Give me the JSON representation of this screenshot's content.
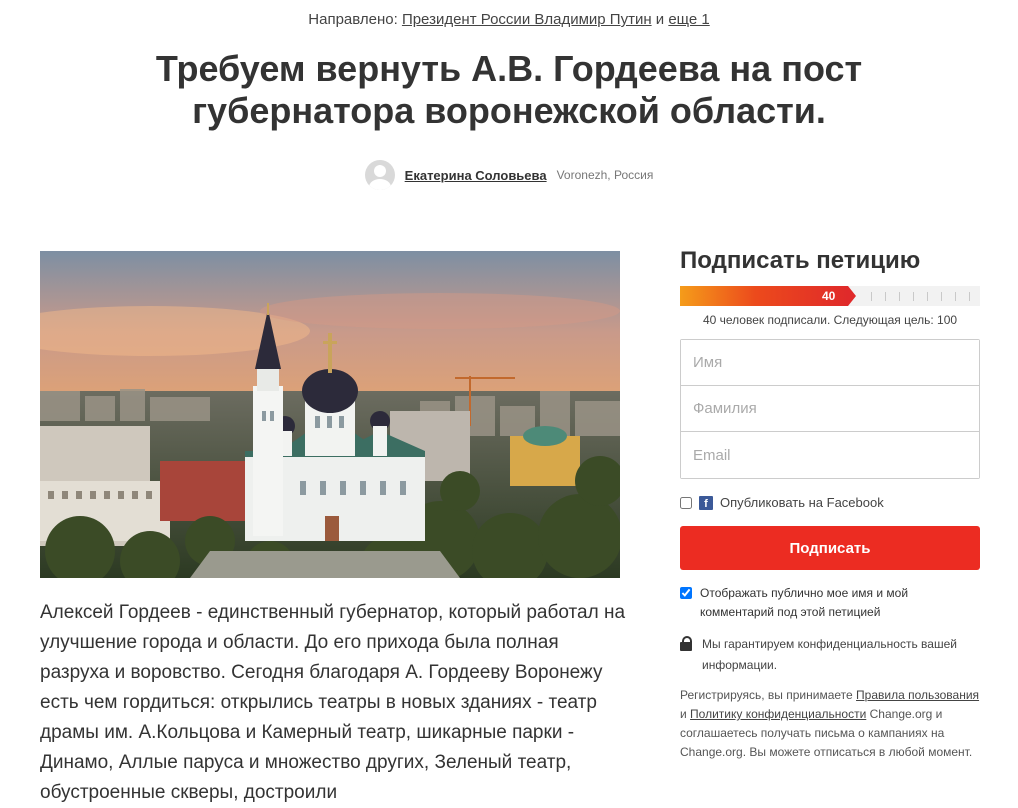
{
  "header": {
    "directed_prefix": "Направлено:",
    "directed_target": "Президент России Владимир Путин",
    "directed_and": "и",
    "directed_more": "еще 1"
  },
  "petition": {
    "title": "Требуем вернуть А.В. Гордеева на пост губернатора воронежской области.",
    "author_name": "Екатерина Соловьева",
    "author_location": "Voronezh, Россия",
    "body": "Алексей Гордеев - единственный губернатор, который работал на улучшение города и области. До его прихода была полная разруха и воровство. Сегодня благодаря А. Гордееву Воронежу есть чем гордиться: открылись театры в новых зданиях - театр драмы им. А.Кольцова и Камерный театр, шикарные парки - Динамо, Аллые паруса и множество других, Зеленый театр, обустроенные скверы, достроили"
  },
  "sign_panel": {
    "title": "Подписать петицию",
    "progress": {
      "count_label": "40",
      "current": 40,
      "goal": 100
    },
    "progress_caption": "40 человек подписали. Следующая цель: 100",
    "fields": {
      "first_name_placeholder": "Имя",
      "last_name_placeholder": "Фамилия",
      "email_placeholder": "Email"
    },
    "facebook_label": "Опубликовать на Facebook",
    "facebook_checked": false,
    "sign_button": "Подписать",
    "public_label": "Отображать публично мое имя и мой комментарий под этой петицией",
    "public_checked": true,
    "privacy_text": "Мы гарантируем конфиденциальность вашей информации.",
    "legal_prefix": "Регистрируясь, вы принимаете",
    "legal_terms_link": "Правила пользования",
    "legal_and": "и",
    "legal_privacy_link": "Политику конфиденциальности",
    "legal_suffix": "Change.org и соглашаетесь получать письма о кампаниях на Change.org. Вы можете отписаться в любой момент."
  },
  "icons": {
    "avatar": "user-avatar-icon",
    "facebook": "facebook-icon",
    "lock": "lock-icon"
  },
  "colors": {
    "sign_button": "#ec2c22",
    "progress_start": "#f59c1a",
    "progress_end": "#e02a2a",
    "facebook": "#3b5998"
  }
}
